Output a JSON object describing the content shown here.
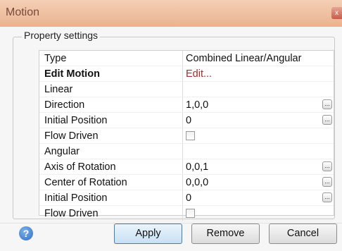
{
  "window": {
    "title": "Motion",
    "close_label": "x"
  },
  "group": {
    "label": "Property settings"
  },
  "properties": [
    {
      "name": "Type",
      "value": "Combined Linear/Angular",
      "style": "normal",
      "control": "text"
    },
    {
      "name": "Edit Motion",
      "value": "Edit...",
      "style": "bold-red",
      "control": "link"
    },
    {
      "name": "Linear",
      "value": "",
      "style": "category",
      "control": "none"
    },
    {
      "name": "Direction",
      "value": "1,0,0",
      "style": "normal",
      "control": "ellipsis"
    },
    {
      "name": "Initial Position",
      "value": "0",
      "style": "normal",
      "control": "ellipsis"
    },
    {
      "name": "Flow Driven",
      "value": "",
      "style": "normal",
      "control": "checkbox"
    },
    {
      "name": "Angular",
      "value": "",
      "style": "category",
      "control": "none"
    },
    {
      "name": "Axis of Rotation",
      "value": "0,0,1",
      "style": "normal",
      "control": "ellipsis"
    },
    {
      "name": "Center of Rotation",
      "value": "0,0,0",
      "style": "normal",
      "control": "ellipsis"
    },
    {
      "name": "Initial Position",
      "value": "0",
      "style": "normal",
      "control": "ellipsis"
    },
    {
      "name": "Flow Driven",
      "value": "",
      "style": "normal",
      "control": "checkbox"
    }
  ],
  "buttons": {
    "apply": "Apply",
    "remove": "Remove",
    "cancel": "Cancel"
  },
  "help_icon": "?",
  "colors": {
    "titlebar": "#eab392",
    "edit_red": "#a0302c",
    "category_orange": "#d2782f",
    "primary_border": "#3c7fb1"
  }
}
